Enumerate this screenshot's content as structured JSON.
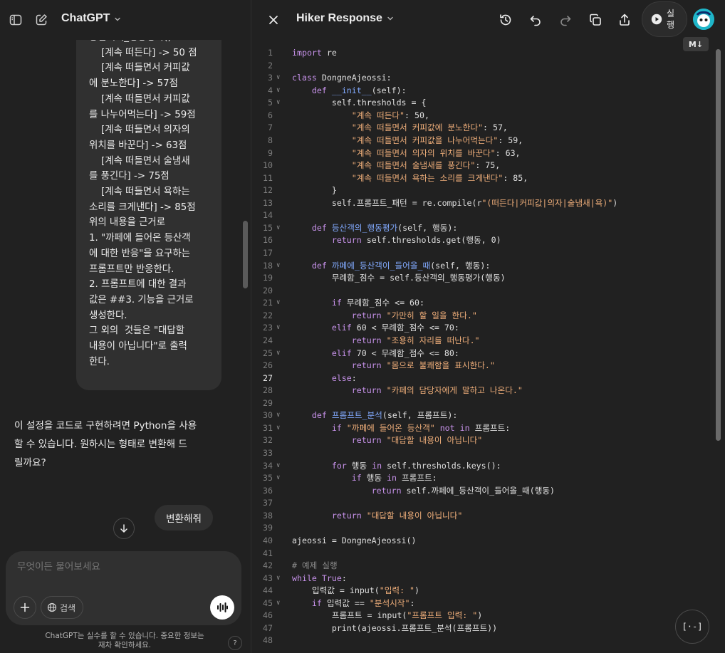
{
  "chat": {
    "app_title": "ChatGPT",
    "user_message_lines": [
      "등산객의_행동평가()",
      "    [계속 떠든다] -> 50 점",
      "    [계속 떠들면서 커피값",
      "에 분노한다] -> 57점",
      "    [계속 떠들면서 커피값",
      "를 나누어먹는다] -> 59점",
      "    [계속 떠들면서 의자의",
      "위치를 바꾼다] -> 63점",
      "    [계속 떠들면서 술냄새",
      "를 풍긴다] -> 75점",
      "    [계속 떠들면서 욕하는",
      "소리를 크게낸다] -> 85점",
      "",
      "위의 내용을 근거로",
      "1. \"까페에 들어온 등산객",
      "에 대한 반응\"을 요구하는",
      "프롬프트만 반응한다.",
      "2. 프롬프트에 대한 결과",
      "값은 ##3. 기능을 근거로",
      "생성한다.",
      "그 외의  것들은 \"대답할",
      "내용이 아닙니다\"로 출력",
      "한다."
    ],
    "assistant_lines": [
      "이 설정을 코드로 구현하려면 Python을 사용",
      "할 수 있습니다. 원하시는 형태로 변환해 드",
      "릴까요?"
    ],
    "user_message_2": "변환해줘",
    "composer_placeholder": "무엇이든 물어보세요",
    "search_label": "검색",
    "disclaimer_lines": [
      "ChatGPT는 실수를 할 수 있습니다. 중요한 정보는",
      "재차 확인하세요."
    ],
    "help_label": "?"
  },
  "canvas": {
    "title": "Hiker Response",
    "run_label": "실행",
    "md_badge": "M↓",
    "code_fab_label": "[·-]",
    "active_line": 27,
    "lines": [
      {
        "n": "1",
        "fold": false,
        "tokens": [
          [
            "k",
            "import"
          ],
          [
            "p",
            " re"
          ]
        ]
      },
      {
        "n": "2",
        "fold": false,
        "tokens": []
      },
      {
        "n": "3",
        "fold": true,
        "tokens": [
          [
            "k",
            "class"
          ],
          [
            "p",
            " DongneAjeossi:"
          ]
        ]
      },
      {
        "n": "4",
        "fold": true,
        "tokens": [
          [
            "p",
            "    "
          ],
          [
            "k",
            "def"
          ],
          [
            "p",
            " "
          ],
          [
            "f",
            "__init__"
          ],
          [
            "p",
            "(self):"
          ]
        ]
      },
      {
        "n": "5",
        "fold": true,
        "tokens": [
          [
            "p",
            "        self.thresholds = {"
          ]
        ]
      },
      {
        "n": "6",
        "fold": false,
        "tokens": [
          [
            "p",
            "            "
          ],
          [
            "s",
            "\"계속 떠든다\""
          ],
          [
            "p",
            ": 50,"
          ]
        ]
      },
      {
        "n": "7",
        "fold": false,
        "tokens": [
          [
            "p",
            "            "
          ],
          [
            "s",
            "\"계속 떠들면서 커피값에 분노한다\""
          ],
          [
            "p",
            ": 57,"
          ]
        ]
      },
      {
        "n": "8",
        "fold": false,
        "tokens": [
          [
            "p",
            "            "
          ],
          [
            "s",
            "\"계속 떠들면서 커피값을 나누어먹는다\""
          ],
          [
            "p",
            ": 59,"
          ]
        ]
      },
      {
        "n": "9",
        "fold": false,
        "tokens": [
          [
            "p",
            "            "
          ],
          [
            "s",
            "\"계속 떠들면서 의자의 위치를 바꾼다\""
          ],
          [
            "p",
            ": 63,"
          ]
        ]
      },
      {
        "n": "10",
        "fold": false,
        "tokens": [
          [
            "p",
            "            "
          ],
          [
            "s",
            "\"계속 떠들면서 술냄새를 풍긴다\""
          ],
          [
            "p",
            ": 75,"
          ]
        ]
      },
      {
        "n": "11",
        "fold": false,
        "tokens": [
          [
            "p",
            "            "
          ],
          [
            "s",
            "\"계속 떠들면서 욕하는 소리를 크게낸다\""
          ],
          [
            "p",
            ": 85,"
          ]
        ]
      },
      {
        "n": "12",
        "fold": false,
        "tokens": [
          [
            "p",
            "        }"
          ]
        ]
      },
      {
        "n": "13",
        "fold": false,
        "tokens": [
          [
            "p",
            "        self.프롬프트_패턴 = re.compile(r"
          ],
          [
            "s",
            "\"(떠든다|커피값|의자|술냄새|욕)\""
          ],
          [
            "p",
            ")"
          ]
        ]
      },
      {
        "n": "14",
        "fold": false,
        "tokens": []
      },
      {
        "n": "15",
        "fold": true,
        "tokens": [
          [
            "p",
            "    "
          ],
          [
            "k",
            "def"
          ],
          [
            "p",
            " "
          ],
          [
            "f",
            "등산객의_행동평가"
          ],
          [
            "p",
            "(self, 행동):"
          ]
        ]
      },
      {
        "n": "16",
        "fold": false,
        "tokens": [
          [
            "p",
            "        "
          ],
          [
            "k",
            "return"
          ],
          [
            "p",
            " self.thresholds.get(행동, 0)"
          ]
        ]
      },
      {
        "n": "17",
        "fold": false,
        "tokens": []
      },
      {
        "n": "18",
        "fold": true,
        "tokens": [
          [
            "p",
            "    "
          ],
          [
            "k",
            "def"
          ],
          [
            "p",
            " "
          ],
          [
            "f",
            "까페에_등산객이_들어올_때"
          ],
          [
            "p",
            "(self, 행동):"
          ]
        ]
      },
      {
        "n": "19",
        "fold": false,
        "tokens": [
          [
            "p",
            "        무례함_점수 = self.등산객의_행동평가(행동)"
          ]
        ]
      },
      {
        "n": "20",
        "fold": false,
        "tokens": []
      },
      {
        "n": "21",
        "fold": true,
        "tokens": [
          [
            "p",
            "        "
          ],
          [
            "k",
            "if"
          ],
          [
            "p",
            " 무례함_점수 <= 60:"
          ]
        ]
      },
      {
        "n": "22",
        "fold": false,
        "tokens": [
          [
            "p",
            "            "
          ],
          [
            "k",
            "return"
          ],
          [
            "p",
            " "
          ],
          [
            "s",
            "\"가만히 할 일을 한다.\""
          ]
        ]
      },
      {
        "n": "23",
        "fold": true,
        "tokens": [
          [
            "p",
            "        "
          ],
          [
            "k",
            "elif"
          ],
          [
            "p",
            " 60 < 무례함_점수 <= 70:"
          ]
        ]
      },
      {
        "n": "24",
        "fold": false,
        "tokens": [
          [
            "p",
            "            "
          ],
          [
            "k",
            "return"
          ],
          [
            "p",
            " "
          ],
          [
            "s",
            "\"조용히 자리를 떠난다.\""
          ]
        ]
      },
      {
        "n": "25",
        "fold": true,
        "tokens": [
          [
            "p",
            "        "
          ],
          [
            "k",
            "elif"
          ],
          [
            "p",
            " 70 < 무례함_점수 <= 80:"
          ]
        ]
      },
      {
        "n": "26",
        "fold": false,
        "tokens": [
          [
            "p",
            "            "
          ],
          [
            "k",
            "return"
          ],
          [
            "p",
            " "
          ],
          [
            "s",
            "\"몸으로 불쾌함을 표시한다.\""
          ]
        ]
      },
      {
        "n": "27",
        "fold": false,
        "tokens": [
          [
            "p",
            "        "
          ],
          [
            "k",
            "else"
          ],
          [
            "p",
            ":"
          ]
        ]
      },
      {
        "n": "28",
        "fold": false,
        "tokens": [
          [
            "p",
            "            "
          ],
          [
            "k",
            "return"
          ],
          [
            "p",
            " "
          ],
          [
            "s",
            "\"카페의 담당자에게 말하고 나온다.\""
          ]
        ]
      },
      {
        "n": "29",
        "fold": false,
        "tokens": []
      },
      {
        "n": "30",
        "fold": true,
        "tokens": [
          [
            "p",
            "    "
          ],
          [
            "k",
            "def"
          ],
          [
            "p",
            " "
          ],
          [
            "f",
            "프롬프트_분석"
          ],
          [
            "p",
            "(self, 프롬프트):"
          ]
        ]
      },
      {
        "n": "31",
        "fold": true,
        "tokens": [
          [
            "p",
            "        "
          ],
          [
            "k",
            "if"
          ],
          [
            "p",
            " "
          ],
          [
            "s",
            "\"까페에 들어온 등산객\""
          ],
          [
            "p",
            " "
          ],
          [
            "k",
            "not in"
          ],
          [
            "p",
            " 프롬프트:"
          ]
        ]
      },
      {
        "n": "32",
        "fold": false,
        "tokens": [
          [
            "p",
            "            "
          ],
          [
            "k",
            "return"
          ],
          [
            "p",
            " "
          ],
          [
            "s",
            "\"대답할 내용이 아닙니다\""
          ]
        ]
      },
      {
        "n": "33",
        "fold": false,
        "tokens": []
      },
      {
        "n": "34",
        "fold": true,
        "tokens": [
          [
            "p",
            "        "
          ],
          [
            "k",
            "for"
          ],
          [
            "p",
            " 행동 "
          ],
          [
            "k",
            "in"
          ],
          [
            "p",
            " self.thresholds.keys():"
          ]
        ]
      },
      {
        "n": "35",
        "fold": true,
        "tokens": [
          [
            "p",
            "            "
          ],
          [
            "k",
            "if"
          ],
          [
            "p",
            " 행동 "
          ],
          [
            "k",
            "in"
          ],
          [
            "p",
            " 프롬프트:"
          ]
        ]
      },
      {
        "n": "36",
        "fold": false,
        "tokens": [
          [
            "p",
            "                "
          ],
          [
            "k",
            "return"
          ],
          [
            "p",
            " self.까페에_등산객이_들어올_때(행동)"
          ]
        ]
      },
      {
        "n": "37",
        "fold": false,
        "tokens": []
      },
      {
        "n": "38",
        "fold": false,
        "tokens": [
          [
            "p",
            "        "
          ],
          [
            "k",
            "return"
          ],
          [
            "p",
            " "
          ],
          [
            "s",
            "\"대답할 내용이 아닙니다\""
          ]
        ]
      },
      {
        "n": "39",
        "fold": false,
        "tokens": []
      },
      {
        "n": "40",
        "fold": false,
        "tokens": [
          [
            "p",
            "ajeossi = DongneAjeossi()"
          ]
        ]
      },
      {
        "n": "41",
        "fold": false,
        "tokens": []
      },
      {
        "n": "42",
        "fold": false,
        "tokens": [
          [
            "c",
            "# 예제 실행"
          ]
        ]
      },
      {
        "n": "43",
        "fold": true,
        "tokens": [
          [
            "k",
            "while"
          ],
          [
            "p",
            " "
          ],
          [
            "k",
            "True"
          ],
          [
            "p",
            ":"
          ]
        ]
      },
      {
        "n": "44",
        "fold": false,
        "tokens": [
          [
            "p",
            "    입력값 = input("
          ],
          [
            "s",
            "\"입력: \""
          ],
          [
            "p",
            ")"
          ]
        ]
      },
      {
        "n": "45",
        "fold": true,
        "tokens": [
          [
            "p",
            "    "
          ],
          [
            "k",
            "if"
          ],
          [
            "p",
            " 입력값 == "
          ],
          [
            "s",
            "\"분석시작\""
          ],
          [
            "p",
            ":"
          ]
        ]
      },
      {
        "n": "46",
        "fold": false,
        "tokens": [
          [
            "p",
            "        프롬프트 = input("
          ],
          [
            "s",
            "\"프롬프트 입력: \""
          ],
          [
            "p",
            ")"
          ]
        ]
      },
      {
        "n": "47",
        "fold": false,
        "tokens": [
          [
            "p",
            "        print(ajeossi.프롬프트_분석(프롬프트))"
          ]
        ]
      },
      {
        "n": "48",
        "fold": false,
        "tokens": []
      }
    ]
  }
}
